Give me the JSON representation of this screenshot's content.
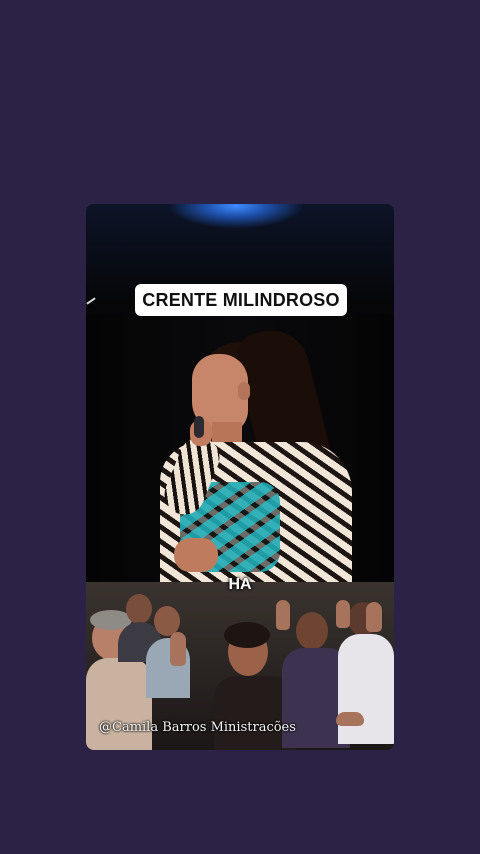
{
  "video": {
    "title_badge": "CRENTE MILINDROSO",
    "caption": "HA",
    "watermark": "@Camila Barros Ministracões"
  },
  "colors": {
    "page_background": "#2b2246",
    "badge_background": "#ffffff",
    "badge_text": "#111111",
    "stage_light": "#3d8cff"
  }
}
